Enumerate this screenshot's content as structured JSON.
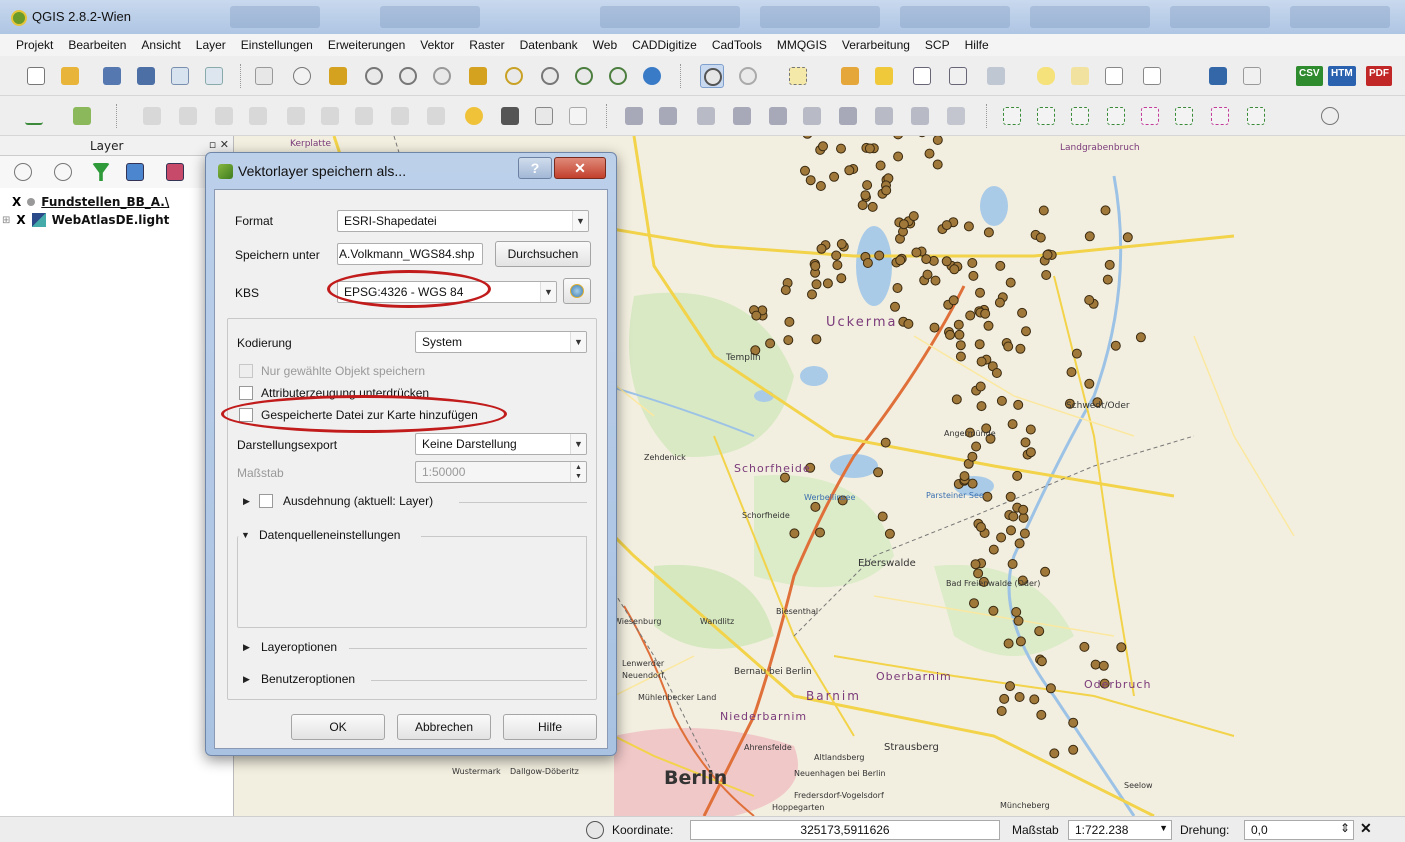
{
  "window": {
    "title": "QGIS 2.8.2-Wien"
  },
  "menubar": {
    "items": [
      "Projekt",
      "Bearbeiten",
      "Ansicht",
      "Layer",
      "Einstellungen",
      "Erweiterungen",
      "Vektor",
      "Raster",
      "Datenbank",
      "Web",
      "CADDigitize",
      "CadTools",
      "MMQGIS",
      "Verarbeitung",
      "SCP",
      "Hilfe"
    ]
  },
  "toolbar": {
    "csv_label": "CSV",
    "htm_label": "HTM",
    "pdf_label": "PDF"
  },
  "layer_panel": {
    "title": "Layer",
    "layers": [
      {
        "label": "Fundstellen_BB_A.\\",
        "checked": "X"
      },
      {
        "label": "WebAtlasDE.light",
        "checked": "X"
      }
    ]
  },
  "map": {
    "labels": [
      "Uckerma",
      "Templin",
      "Schorfheide",
      "Schorfheide",
      "Angermünde",
      "Schwedt/Oder",
      "Eberswalde",
      "Bad Freienwalde (Oder)",
      "Berlin",
      "Bernau bei Berlin",
      "Barnim",
      "Oberbarnim",
      "Oderbruch",
      "Niederbarnim",
      "Strausberg",
      "Zehdenick",
      "Biesenthal",
      "Wandlitz",
      "Werbellinsee",
      "Parsteiner See",
      "Landgrabenbruch",
      "Mühlenbecker Land",
      "Wustermark",
      "Seelow",
      "Müncheberg",
      "Altlandsberg",
      "Ahrensfelde",
      "Hoppegarten",
      "Neuenhagen bei Berlin",
      "Fredersdorf-Vogelsdorf",
      "Dallgow-Döberitz",
      "Lenwerder",
      "Neuendorf",
      "Kerplatte",
      "Wiesenburg"
    ]
  },
  "dialog": {
    "title": "Vektorlayer speichern als...",
    "help_glyph": "?",
    "close_glyph": "✕",
    "format_label": "Format",
    "format_value": "ESRI-Shapedatei",
    "save_as_label": "Speichern unter",
    "save_as_value": "A.Volkmann_WGS84.shp",
    "browse_button": "Durchsuchen",
    "crs_label": "KBS",
    "crs_value": "EPSG:4326 - WGS 84",
    "encoding_label": "Kodierung",
    "encoding_value": "System",
    "only_selected_label": "Nur gewählte Objekt speichern",
    "suppress_attrs_label": "Attributerzeugung unterdrücken",
    "add_to_map_label": "Gespeicherte Datei zur Karte hinzufügen",
    "symbology_export_label": "Darstellungsexport",
    "symbology_export_value": "Keine Darstellung",
    "scale_label": "Maßstab",
    "scale_value": "1:50000",
    "extent_label": "Ausdehnung (aktuell: Layer)",
    "datasource_label": "Datenquelleneinstellungen",
    "layer_options_label": "Layeroptionen",
    "custom_options_label": "Benutzeroptionen",
    "ok_button": "OK",
    "cancel_button": "Abbrechen",
    "help_button": "Hilfe"
  },
  "statusbar": {
    "coordinate_label": "Koordinate:",
    "coordinate_value": "325173,5911626",
    "scale_label": "Maßstab",
    "scale_value": "1:722.238",
    "rotation_label": "Drehung:",
    "rotation_value": "0,0"
  },
  "colors": {
    "highlight": "#c11b1b",
    "point_fill": "#a0783a",
    "titlebar": "#b8cde8"
  }
}
